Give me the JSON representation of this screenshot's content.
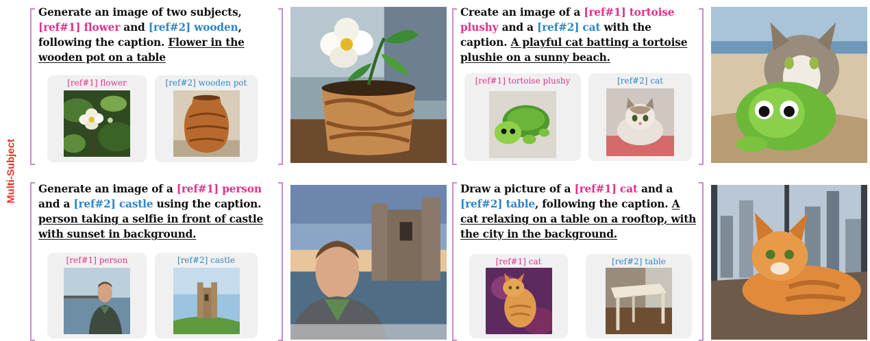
{
  "side_label": "Multi-Subject",
  "panels": [
    {
      "prompt_pre": "Generate an image of two subjects, ",
      "ref1_token": "[ref#1] flower",
      "joiner": " and ",
      "ref2_token": "[ref#2] wooden",
      "prompt_mid": ", following the caption. ",
      "caption": "Flower in the wooden pot on a table",
      "ref1_label": "[ref#1] flower",
      "ref2_label": "[ref#2] wooden pot"
    },
    {
      "prompt_pre": "Create an image of a ",
      "ref1_token": "[ref#1] tortoise plushy",
      "joiner": " and a ",
      "ref2_token": "[ref#2] cat",
      "prompt_mid": " with the caption. ",
      "caption": "A playful cat batting a tortoise plushie on a sunny beach.",
      "ref1_label": "[ref#1] tortoise plushy",
      "ref2_label": "[ref#2] cat"
    },
    {
      "prompt_pre": "Generate an image of a ",
      "ref1_token": "[ref#1] person",
      "joiner": " and a ",
      "ref2_token": "[ref#2] castle",
      "prompt_mid": " using the caption. ",
      "caption": "person taking a selfie in front of castle with sunset in background.",
      "ref1_label": "[ref#1] person",
      "ref2_label": "[ref#2] castle"
    },
    {
      "prompt_pre": "Draw a picture of a ",
      "ref1_token": "[ref#1] cat",
      "joiner": " and a ",
      "ref2_token": "[ref#2] table",
      "prompt_mid": ", following the caption. ",
      "caption": "A cat relaxing on a table on a rooftop, with the city in the background.",
      "ref1_label": "[ref#1] cat",
      "ref2_label": "[ref#2] table"
    }
  ],
  "colors": {
    "ref1": "#e0328c",
    "ref2": "#2f86c5",
    "side_label": "#e8312a",
    "bracket": "#c98ac9"
  }
}
